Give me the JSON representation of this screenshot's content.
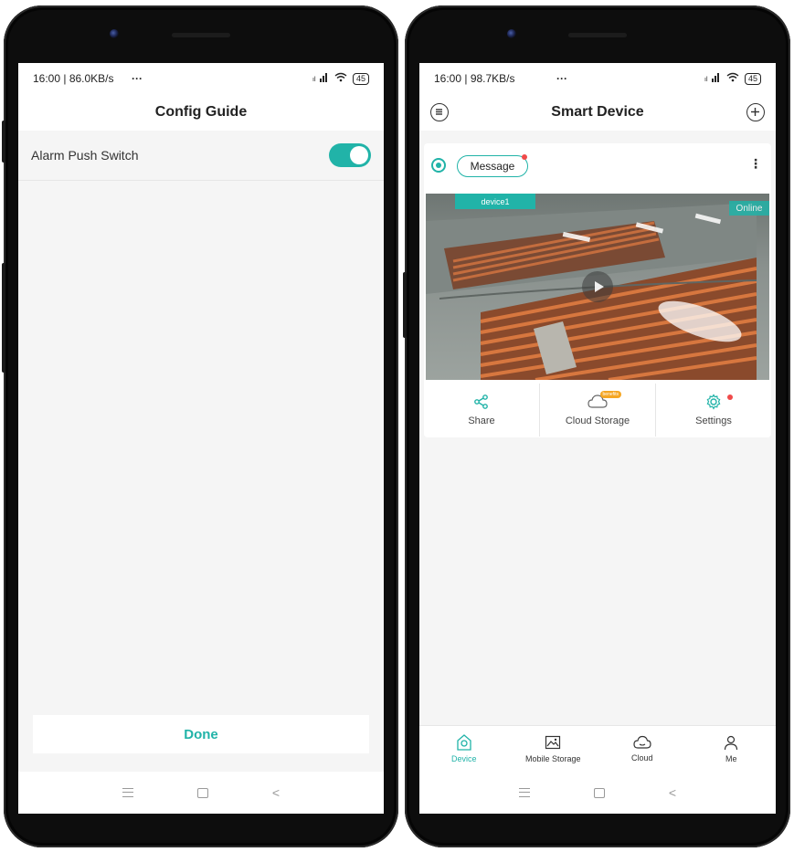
{
  "left_screen": {
    "status": {
      "time_speed": "16:00 | 86.0KB/s",
      "more": "…",
      "signal": "ᴸᵀᴱ ıll",
      "wifi": "≈",
      "battery": "45"
    },
    "title": "Config Guide",
    "setting_label": "Alarm Push Switch",
    "toggle_state": "on",
    "done_label": "Done"
  },
  "right_screen": {
    "status": {
      "time_speed": "16:00 | 98.7KB/s",
      "more": "…",
      "signal": "ıll",
      "wifi": "≈",
      "battery": "45"
    },
    "title": "Smart Device",
    "message_label": "Message",
    "device_name": "device1",
    "online_label": "Online",
    "actions": [
      {
        "label": "Share",
        "icon": "share-icon"
      },
      {
        "label": "Cloud Storage",
        "icon": "cloud-icon",
        "badge": "benefits"
      },
      {
        "label": "Settings",
        "icon": "gear-icon"
      }
    ],
    "tabs": [
      {
        "label": "Device",
        "icon": "device-icon",
        "active": true
      },
      {
        "label": "Mobile Storage",
        "icon": "image-icon",
        "active": false
      },
      {
        "label": "Cloud",
        "icon": "cloud-icon",
        "active": false
      },
      {
        "label": "Me",
        "icon": "person-icon",
        "active": false
      }
    ]
  },
  "colors": {
    "accent": "#21b3a8",
    "notification_dot": "#f04a4a",
    "background": "#f5f5f5"
  }
}
